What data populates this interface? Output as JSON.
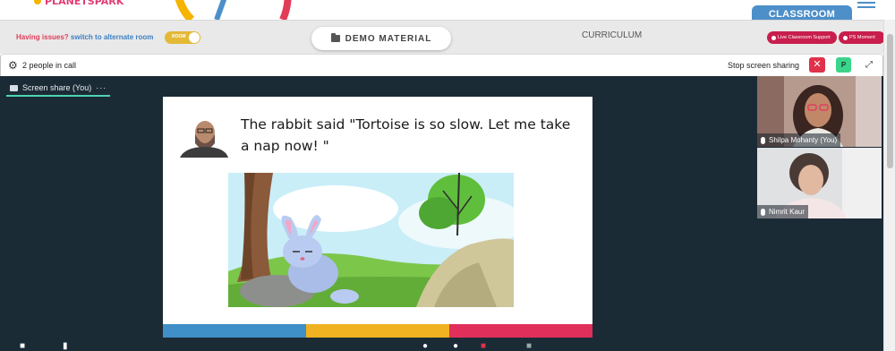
{
  "brand": {
    "logo_text": "PLANETSPARK"
  },
  "header": {
    "classroom_tab": "CLASSROOM"
  },
  "toolbar": {
    "issue_text": "Having issues?",
    "issue_link": "switch to alternate room",
    "toggle_label": "ROOM",
    "demo_material_label": "DEMO MATERIAL",
    "curriculum_label": "CURRICULUM",
    "support_pill": "Live Classroom Support",
    "moment_pill": "PS Moment"
  },
  "call": {
    "people_count_text": "2 people in call",
    "stop_share_label": "Stop screen sharing",
    "close_symbol": "✕",
    "p_button_label": "P",
    "expand_symbol": "⤢"
  },
  "screenshare": {
    "tab_label": "Screen share (You)",
    "more_symbol": "···"
  },
  "slide": {
    "text": "The rabbit said \"Tortoise is so slow. Let me take a nap now! \""
  },
  "participants": [
    {
      "name": "Shilpa Mohanty (You)"
    },
    {
      "name": "Nimrit Kaur"
    }
  ],
  "colors": {
    "stage_bg": "#1b2b36",
    "accent_blue": "#4d8fc9",
    "accent_red": "#e0314b",
    "accent_green": "#3bd48a",
    "brand_yellow": "#f0b221",
    "brand_pink": "#e12f5b"
  },
  "icons": [
    "gear-icon",
    "close-icon",
    "expand-icon",
    "folder-icon",
    "mic-icon",
    "screen-icon",
    "more-icon"
  ]
}
